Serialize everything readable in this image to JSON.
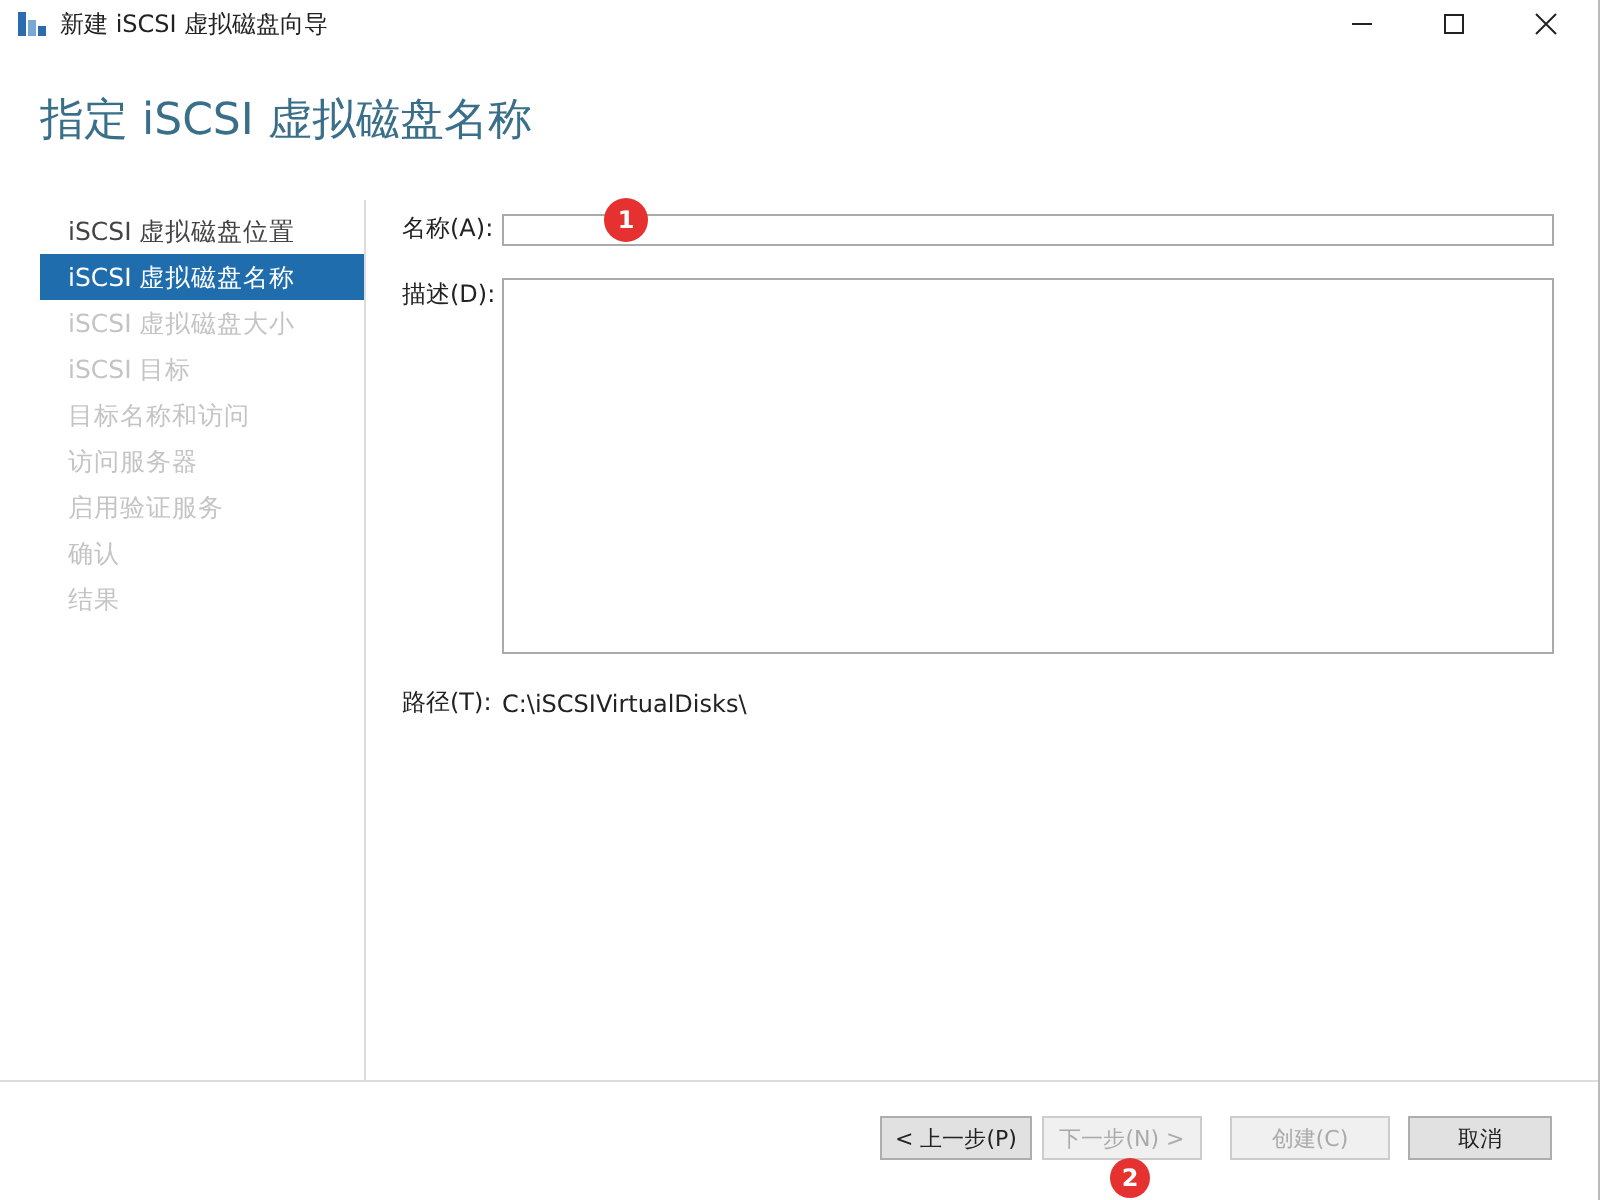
{
  "window": {
    "title": "新建 iSCSI 虚拟磁盘向导"
  },
  "header": "指定 iSCSI 虚拟磁盘名称",
  "steps": [
    {
      "label": "iSCSI 虚拟磁盘位置",
      "selected": false,
      "disabled": false
    },
    {
      "label": "iSCSI 虚拟磁盘名称",
      "selected": true,
      "disabled": false
    },
    {
      "label": "iSCSI 虚拟磁盘大小",
      "selected": false,
      "disabled": true
    },
    {
      "label": "iSCSI 目标",
      "selected": false,
      "disabled": true
    },
    {
      "label": "目标名称和访问",
      "selected": false,
      "disabled": true
    },
    {
      "label": "访问服务器",
      "selected": false,
      "disabled": true
    },
    {
      "label": "启用验证服务",
      "selected": false,
      "disabled": true
    },
    {
      "label": "确认",
      "selected": false,
      "disabled": true
    },
    {
      "label": "结果",
      "selected": false,
      "disabled": true
    }
  ],
  "form": {
    "name_label": "名称(A):",
    "description_label": "描述(D):",
    "path_label": "路径(T):",
    "path_value": "C:\\iSCSIVirtualDisks\\"
  },
  "buttons": [
    {
      "label": "< 上一步(P)",
      "disabled": false
    },
    {
      "label": "下一步(N) >",
      "disabled": true
    },
    {
      "label": "创建(C)",
      "disabled": true
    },
    {
      "label": "取消",
      "disabled": false
    }
  ],
  "callouts": [
    "1",
    "2"
  ]
}
